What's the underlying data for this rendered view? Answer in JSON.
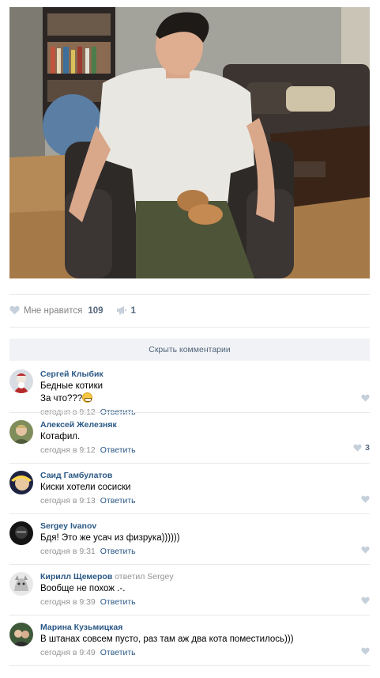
{
  "post": {
    "likes_label": "Мне нравится",
    "likes_count": "109",
    "shares_count": "1",
    "hide_comments_label": "Скрыть комментарии"
  },
  "colors": {
    "link": "#2a5885",
    "muted": "#939393",
    "hide_bar_bg": "#f0f2f5",
    "like_icon": "#c5d0db"
  },
  "comments": [
    {
      "author": "Сергей Клыбик",
      "lines": [
        "Бедные котики",
        "За что???"
      ],
      "emoji": "grin-emoji",
      "time": "сегодня в 9:12",
      "reply_label": "Ответить",
      "likes": ""
    },
    {
      "author": "Алексей Железняк",
      "lines": [
        "Котафил."
      ],
      "time": "сегодня в 9:12",
      "reply_label": "Ответить",
      "likes": "3"
    },
    {
      "author": "Саид Гамбулатов",
      "lines": [
        "Киски хотели сосиски"
      ],
      "time": "сегодня в 9:13",
      "reply_label": "Ответить",
      "likes": ""
    },
    {
      "author": "Sergey Ivanov",
      "lines": [
        "Бдя! Это же усач из физрука))))))"
      ],
      "time": "сегодня в 9:31",
      "reply_label": "Ответить",
      "likes": ""
    },
    {
      "author": "Кирилл Щемеров",
      "reply_to_label": "ответил",
      "reply_to_name": "Sergey",
      "lines": [
        "Вообще не похож .-."
      ],
      "time": "сегодня в 9:39",
      "reply_label": "Ответить",
      "likes": ""
    },
    {
      "author": "Марина Кузьмицкая",
      "lines": [
        "В штанах совсем пусто, раз там аж два кота поместилось)))"
      ],
      "time": "сегодня в 9:49",
      "reply_label": "Ответить",
      "likes": ""
    }
  ]
}
